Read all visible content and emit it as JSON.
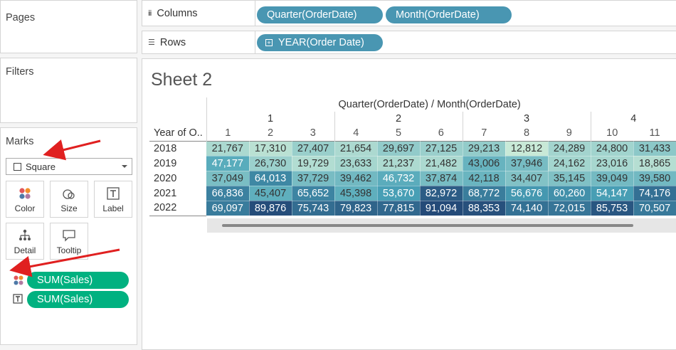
{
  "left": {
    "pages_title": "Pages",
    "filters_title": "Filters",
    "marks_title": "Marks",
    "mark_type": "Square",
    "cards": {
      "color": "Color",
      "size": "Size",
      "label": "Label",
      "detail": "Detail",
      "tooltip": "Tooltip"
    },
    "mark_fields": [
      "SUM(Sales)",
      "SUM(Sales)"
    ]
  },
  "shelves": {
    "columns_label": "Columns",
    "rows_label": "Rows",
    "column_pills": [
      "Quarter(OrderDate)",
      "Month(OrderDate)"
    ],
    "row_pill": "YEAR(Order Date)"
  },
  "sheet": {
    "title": "Sheet 2",
    "header_title": "Quarter(OrderDate) / Month(OrderDate)",
    "row_header": "Year of O..",
    "quarters": [
      "1",
      "2",
      "3",
      "4"
    ],
    "months": [
      "1",
      "2",
      "3",
      "4",
      "5",
      "6",
      "7",
      "8",
      "9",
      "10",
      "11"
    ],
    "years": [
      "2018",
      "2019",
      "2020",
      "2021",
      "2022"
    ],
    "values": [
      [
        "21,767",
        "17,310",
        "27,407",
        "21,654",
        "29,697",
        "27,125",
        "29,213",
        "12,812",
        "24,289",
        "24,800",
        "31,433"
      ],
      [
        "47,177",
        "26,730",
        "19,729",
        "23,633",
        "21,237",
        "21,482",
        "43,006",
        "37,946",
        "24,162",
        "23,016",
        "18,865"
      ],
      [
        "37,049",
        "64,013",
        "37,729",
        "39,462",
        "46,732",
        "37,874",
        "42,118",
        "34,407",
        "35,145",
        "39,049",
        "39,580"
      ],
      [
        "66,836",
        "45,407",
        "65,652",
        "45,398",
        "53,670",
        "82,972",
        "68,772",
        "56,676",
        "60,260",
        "54,147",
        "74,176"
      ],
      [
        "69,097",
        "89,876",
        "75,743",
        "79,823",
        "77,815",
        "91,094",
        "88,353",
        "74,140",
        "72,015",
        "85,753",
        "70,507"
      ]
    ],
    "color_min": "#c8e9d7",
    "color_mid": "#4aa3b8",
    "color_max": "#244a78"
  },
  "colors": {
    "accent_blue": "#4996b2",
    "accent_green": "#00b180",
    "annotation_red": "#e02020"
  }
}
